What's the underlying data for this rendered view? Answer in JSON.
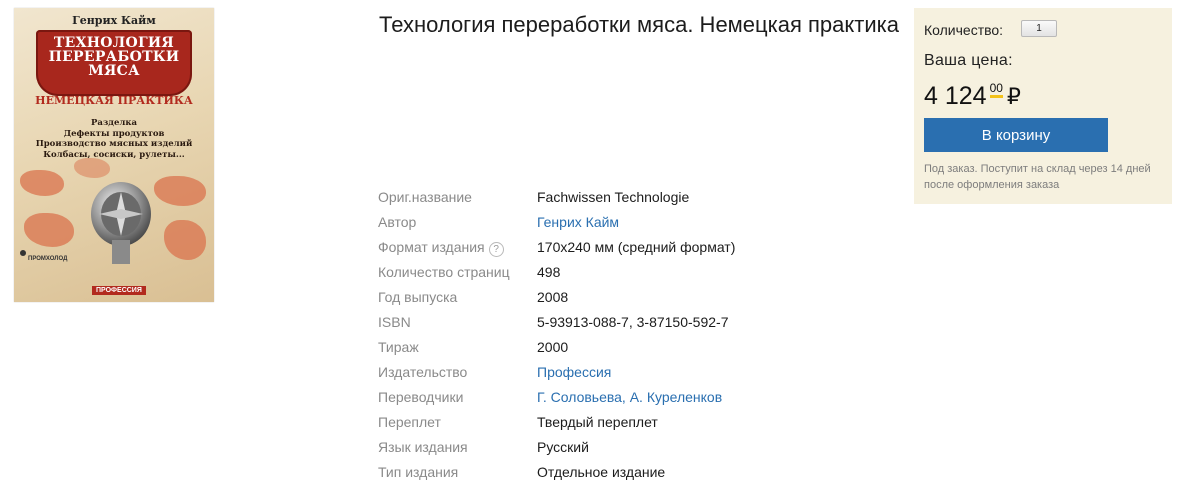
{
  "cover": {
    "author": "Генрих Кайм",
    "title_lines": [
      "ТЕХНОЛОГИЯ",
      "ПЕРЕРАБОТКИ",
      "МЯСА"
    ],
    "subtitle": "НЕМЕЦКАЯ ПРАКТИКА",
    "topics": [
      "Разделка",
      "Дефекты продуктов",
      "Производство мясных изделий",
      "Колбасы, сосиски, рулеты..."
    ],
    "logo_text": "ПРОМХОЛОД",
    "publisher_text": "ПРОФЕССИЯ"
  },
  "product": {
    "title": "Технология переработки мяса. Немецкая практика"
  },
  "specs": [
    {
      "label": "Ориг.название",
      "value": "Fachwissen Technologie",
      "link": false
    },
    {
      "label": "Автор",
      "value": "Генрих Кайм",
      "link": true
    },
    {
      "label": "Формат издания",
      "value": "170x240 мм (средний формат)",
      "link": false,
      "help": "?"
    },
    {
      "label": "Количество страниц",
      "value": "498",
      "link": false
    },
    {
      "label": "Год выпуска",
      "value": "2008",
      "link": false
    },
    {
      "label": "ISBN",
      "value": "5-93913-088-7, 3-87150-592-7",
      "link": false
    },
    {
      "label": "Тираж",
      "value": "2000",
      "link": false
    },
    {
      "label": "Издательство",
      "value": "Профессия",
      "link": true
    },
    {
      "label": "Переводчики",
      "value": "Г. Соловьева, А. Куреленков",
      "link": true
    },
    {
      "label": "Переплет",
      "value": "Твердый переплет",
      "link": false
    },
    {
      "label": "Язык издания",
      "value": "Русский",
      "link": false
    },
    {
      "label": "Тип издания",
      "value": "Отдельное издание",
      "link": false
    }
  ],
  "purchase": {
    "quantity_label": "Количество:",
    "quantity_value": "1",
    "price_label": "Ваша цена:",
    "price_rub": "4 124",
    "price_kop": "00",
    "currency": "₽",
    "cart_button": "В корзину",
    "availability": "Под заказ. Поступит на склад через 14 дней после оформления заказа"
  },
  "colors": {
    "link": "#2a6fb0",
    "button": "#2a6fb0",
    "price_box_bg": "#f6f1df",
    "price_underline": "#f3c21a"
  }
}
